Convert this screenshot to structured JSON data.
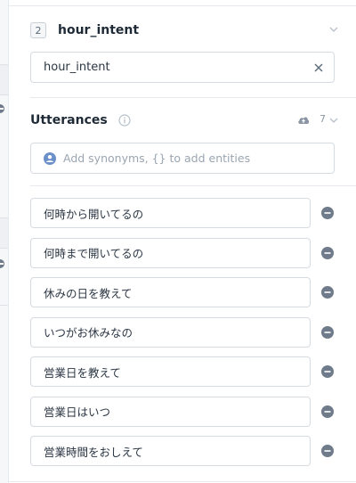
{
  "intent": {
    "number": "2",
    "title": "hour_intent",
    "name_value": "hour_intent"
  },
  "utterances": {
    "title": "Utterances",
    "count": "7",
    "synonym_placeholder": "Add synonyms, {} to add entities",
    "items": [
      "何時から開いてるの",
      "何時まで開いてるの",
      "休みの日を教えて",
      "いつがお休みなの",
      "営業日を教えて",
      "営業日はいつ",
      "営業時間をおしえて"
    ]
  },
  "colors": {
    "text": "#1f2a37",
    "border": "#d6dbe1",
    "icon_gray": "#6f7b8a",
    "info_gray": "#b7c0ca",
    "user_icon_blue": "#6b8fc9"
  },
  "icons": [
    "chevron-down-icon",
    "close-icon",
    "info-icon",
    "upload-icon",
    "user-icon",
    "remove-icon"
  ]
}
